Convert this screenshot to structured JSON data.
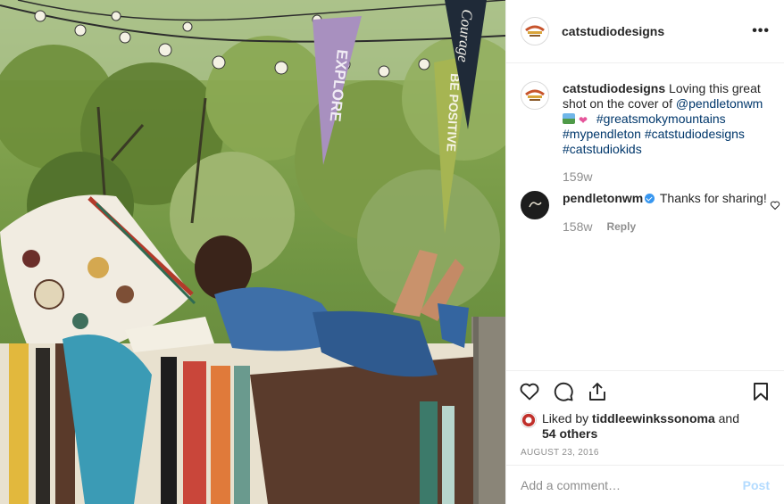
{
  "header": {
    "username": "catstudiodesigns",
    "more_label": "•••"
  },
  "caption": {
    "username": "catstudiodesigns",
    "text_before": "Loving this great shot on the cover of ",
    "mention": "@pendletonwm",
    "hashtags_line1": "#greatsmokymountains",
    "hashtags_line2": "#mypendleton #catstudiodesigns",
    "hashtags_line3": "#catstudiokids",
    "time": "159w"
  },
  "reply_comment": {
    "username": "pendletonwm",
    "text": "Thanks for sharing!",
    "time": "158w",
    "reply_label": "Reply"
  },
  "likes": {
    "prefix": "Liked by ",
    "user": "tiddleewinkssonoma",
    "middle": " and",
    "others": "54 others"
  },
  "date": "AUGUST 23, 2016",
  "comment_box": {
    "placeholder": "Add a comment…",
    "post_label": "Post"
  },
  "photo": {
    "pennants": [
      "EXPLORE",
      "BE POSITIVE",
      "Courage"
    ]
  },
  "colors": {
    "link": "#00376b",
    "verified": "#3897f0",
    "post_disabled": "#b3dbff"
  }
}
